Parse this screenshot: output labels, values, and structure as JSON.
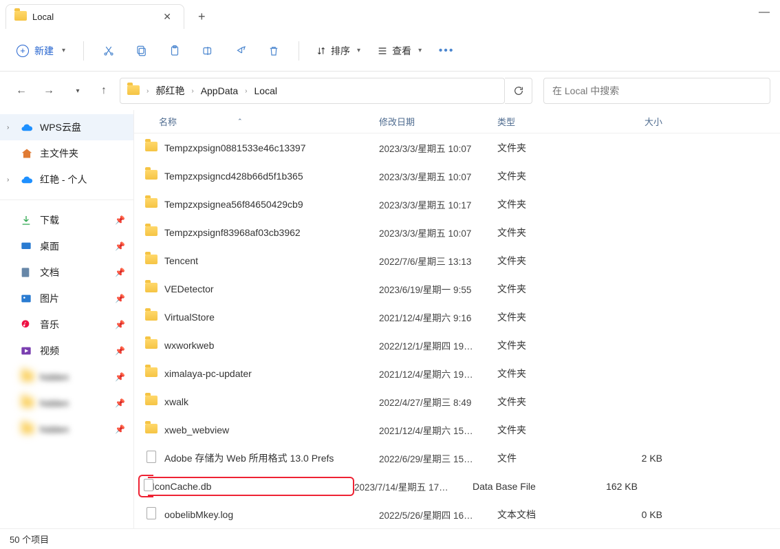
{
  "window": {
    "tab_title": "Local"
  },
  "toolbar": {
    "new_label": "新建",
    "sort_label": "排序",
    "view_label": "查看"
  },
  "breadcrumbs": [
    "郝红艳",
    "AppData",
    "Local"
  ],
  "search": {
    "placeholder": "在 Local 中搜索"
  },
  "sidebar": {
    "top": [
      {
        "label": "WPS云盘",
        "expandable": true,
        "cloud": true,
        "selected": true
      },
      {
        "label": "主文件夹",
        "expandable": false,
        "home": true
      },
      {
        "label": "红艳 - 个人",
        "expandable": true,
        "cloud": true
      }
    ],
    "quick": [
      {
        "label": "下载"
      },
      {
        "label": "桌面"
      },
      {
        "label": "文档"
      },
      {
        "label": "图片"
      },
      {
        "label": "音乐"
      },
      {
        "label": "视频"
      }
    ],
    "blurred_count": 3
  },
  "columns": {
    "name": "名称",
    "modified": "修改日期",
    "type": "类型",
    "size": "大小"
  },
  "files": [
    {
      "name": "Tempzxpsign0881533e46c13397",
      "date": "2023/3/3/星期五 10:07",
      "type": "文件夹",
      "size": "",
      "folder": true
    },
    {
      "name": "Tempzxpsigncd428b66d5f1b365",
      "date": "2023/3/3/星期五 10:07",
      "type": "文件夹",
      "size": "",
      "folder": true
    },
    {
      "name": "Tempzxpsignea56f84650429cb9",
      "date": "2023/3/3/星期五 10:17",
      "type": "文件夹",
      "size": "",
      "folder": true
    },
    {
      "name": "Tempzxpsignf83968af03cb3962",
      "date": "2023/3/3/星期五 10:07",
      "type": "文件夹",
      "size": "",
      "folder": true
    },
    {
      "name": "Tencent",
      "date": "2022/7/6/星期三 13:13",
      "type": "文件夹",
      "size": "",
      "folder": true
    },
    {
      "name": "VEDetector",
      "date": "2023/6/19/星期一 9:55",
      "type": "文件夹",
      "size": "",
      "folder": true
    },
    {
      "name": "VirtualStore",
      "date": "2021/12/4/星期六 9:16",
      "type": "文件夹",
      "size": "",
      "folder": true
    },
    {
      "name": "wxworkweb",
      "date": "2022/12/1/星期四 19…",
      "type": "文件夹",
      "size": "",
      "folder": true
    },
    {
      "name": "ximalaya-pc-updater",
      "date": "2021/12/4/星期六 19…",
      "type": "文件夹",
      "size": "",
      "folder": true
    },
    {
      "name": "xwalk",
      "date": "2022/4/27/星期三 8:49",
      "type": "文件夹",
      "size": "",
      "folder": true
    },
    {
      "name": "xweb_webview",
      "date": "2021/12/4/星期六 15…",
      "type": "文件夹",
      "size": "",
      "folder": true
    },
    {
      "name": "Adobe 存储为 Web 所用格式 13.0 Prefs",
      "date": "2022/6/29/星期三 15…",
      "type": "文件",
      "size": "2 KB",
      "folder": false
    },
    {
      "name": "IconCache.db",
      "date": "2023/7/14/星期五 17…",
      "type": "Data Base File",
      "size": "162 KB",
      "folder": false,
      "highlight": true
    },
    {
      "name": "oobelibMkey.log",
      "date": "2022/5/26/星期四 16…",
      "type": "文本文档",
      "size": "0 KB",
      "folder": false
    }
  ],
  "status": {
    "item_count": "50 个项目"
  }
}
